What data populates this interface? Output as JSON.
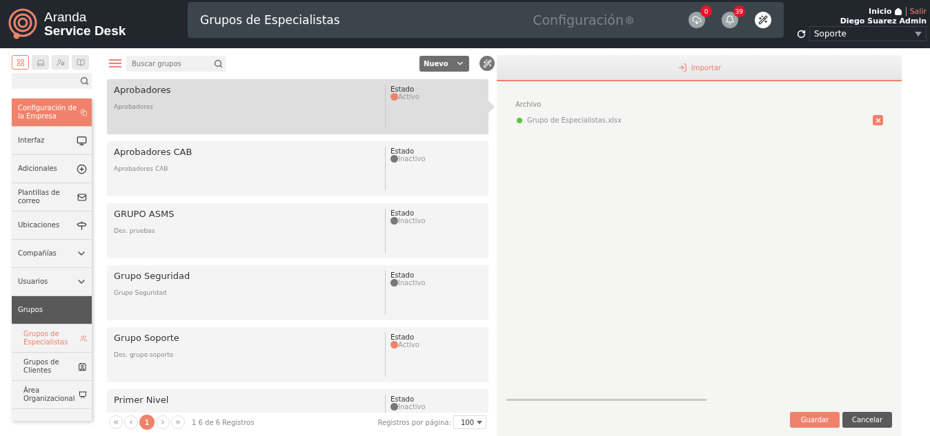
{
  "header": {
    "brand_top": "Aranda",
    "brand_bottom": "Service Desk",
    "title": "Grupos de Especialistas",
    "section": "Configuración",
    "downloads_badge": "0",
    "notifications_badge": "39",
    "home_link": "Inicio",
    "logout_link": "Salir",
    "user": "Diego Suarez Admin",
    "project_select": "Soporte"
  },
  "sidebar": {
    "view_tabs": [
      {
        "selected": true
      },
      {
        "selected": false
      },
      {
        "selected": false
      },
      {
        "selected": false
      }
    ],
    "items": [
      {
        "kind": "header",
        "label": "Configuración de la Empresa"
      },
      {
        "kind": "item",
        "label": "Interfaz"
      },
      {
        "kind": "item",
        "label": "Adicionales"
      },
      {
        "kind": "item",
        "label": "Plantillas de correo"
      },
      {
        "kind": "item",
        "label": "Ubicaciones"
      },
      {
        "kind": "expandable",
        "label": "Compañías",
        "expanded": false
      },
      {
        "kind": "expandable",
        "label": "Usuarios",
        "expanded": false
      },
      {
        "kind": "section",
        "label": "Grupos"
      },
      {
        "kind": "subitem",
        "label": "Grupos de Especialistas",
        "selected": true
      },
      {
        "kind": "subitem",
        "label": "Grupos de Clientes",
        "selected": false
      },
      {
        "kind": "subitem",
        "label": "Área Organizacional",
        "selected": false
      }
    ]
  },
  "list": {
    "search": {
      "placeholder": "Buscar grupos"
    },
    "new_button": "Nuevo",
    "groups": [
      {
        "name": "Aprobadores",
        "description": "Aprobadores",
        "status_label": "Estado",
        "status": "Activo",
        "active": true,
        "selected": true
      },
      {
        "name": "Aprobadores CAB",
        "description": "Aprobadores CAB",
        "status_label": "Estado",
        "status": "Inactivo",
        "active": false,
        "selected": false
      },
      {
        "name": "GRUPO ASMS",
        "description": "Des. pruebas",
        "status_label": "Estado",
        "status": "Inactivo",
        "active": false,
        "selected": false
      },
      {
        "name": "Grupo Seguridad",
        "description": "Grupo Seguridad",
        "status_label": "Estado",
        "status": "Inactivo",
        "active": false,
        "selected": false
      },
      {
        "name": "Grupo Soporte",
        "description": "Des. grupo soporte",
        "status_label": "Estado",
        "status": "Activo",
        "active": true,
        "selected": false
      },
      {
        "name": "Primer Nivel",
        "status_label": "Estado",
        "status": "Inactivo",
        "active": false,
        "selected": false
      }
    ],
    "pagination": {
      "current_page": "1",
      "summary": "1 6 de 6 Registros",
      "per_page_label": "Registros por página:",
      "per_page": "100"
    }
  },
  "detail": {
    "tab": "Importar",
    "file_label": "Archivo",
    "file_name": "Grupo de Especialistas.xlsx",
    "file_uploaded": true,
    "save_button": "Guardar",
    "cancel_button": "Cancelar"
  }
}
